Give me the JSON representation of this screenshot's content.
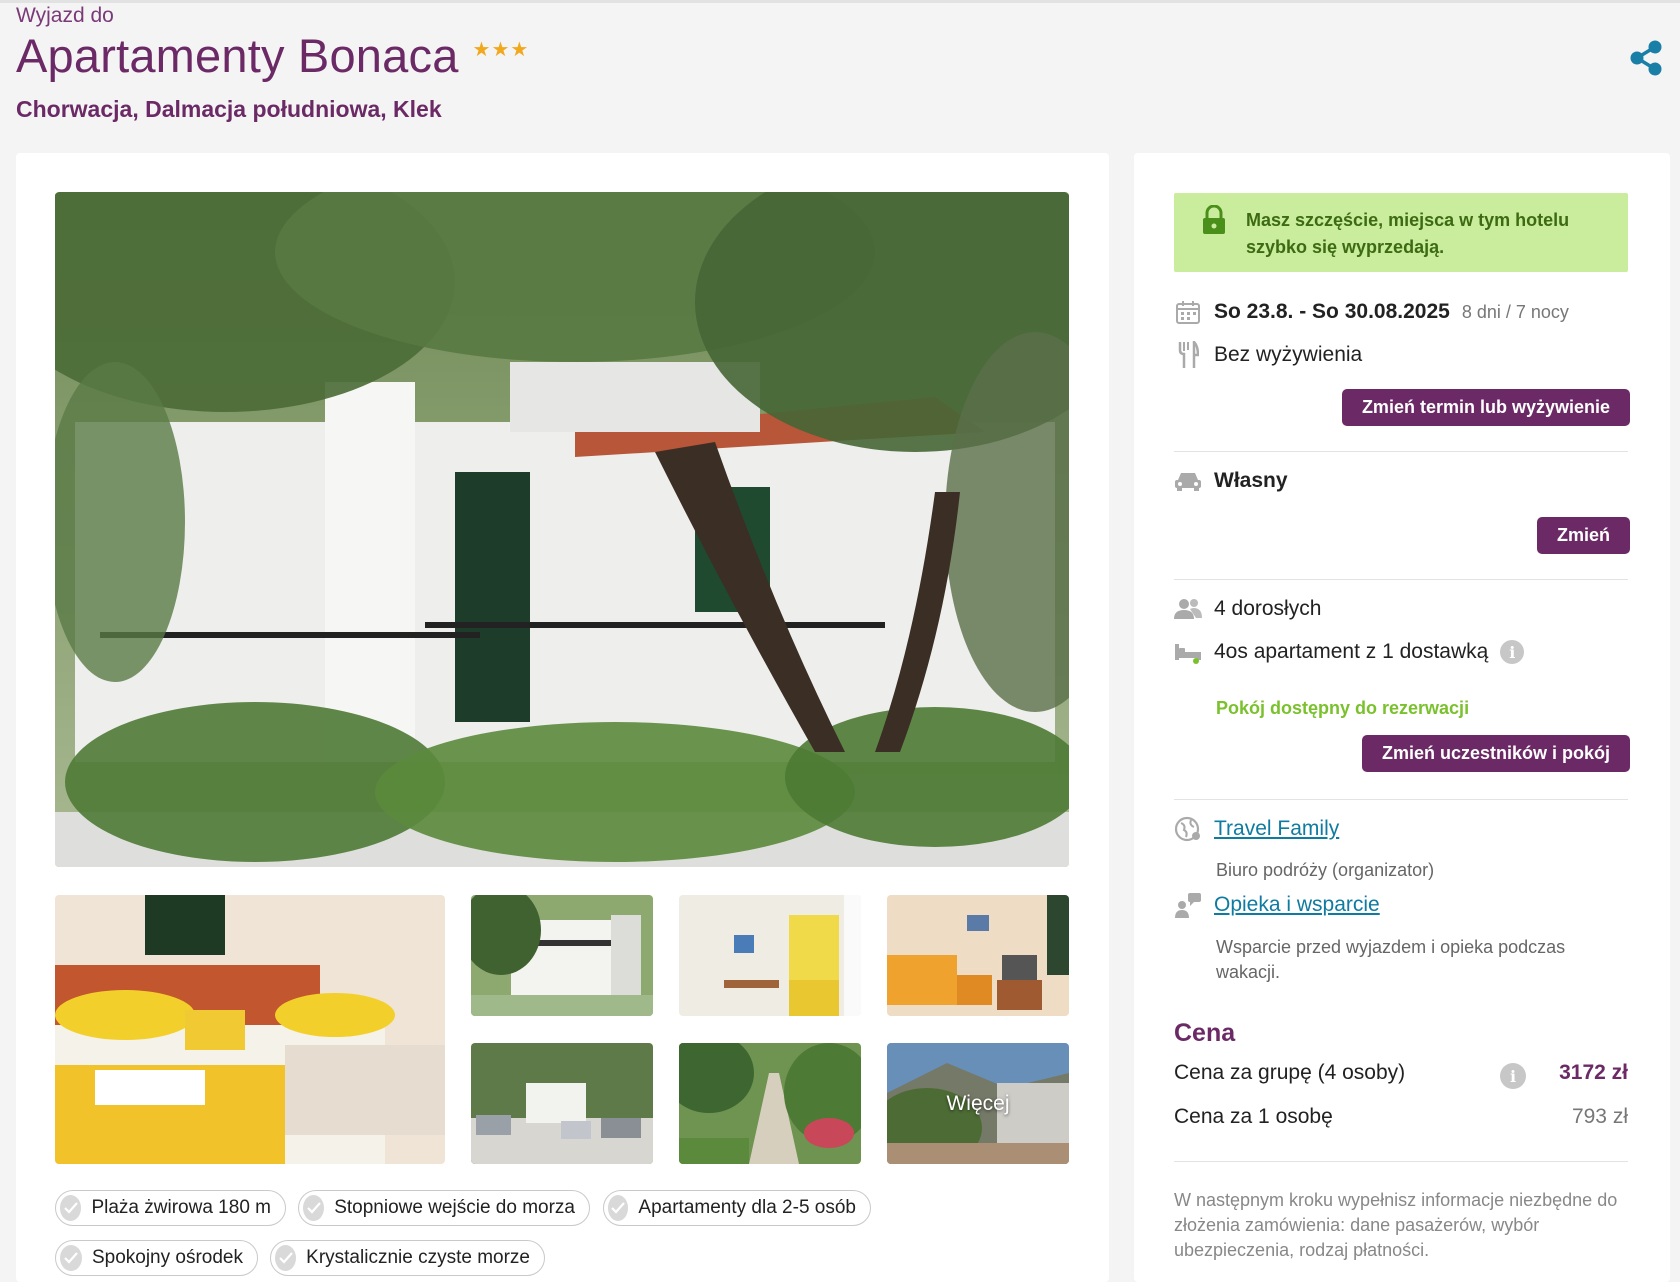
{
  "header": {
    "kicker": "Wyjazd do",
    "title": "Apartamenty Bonaca",
    "stars": "★★★",
    "location": "Chorwacja, Dalmacja południowa, Klek"
  },
  "gallery": {
    "more_label": "Więcej"
  },
  "tags": [
    "Plaża żwirowa 180 m",
    "Stopniowe wejście do morza",
    "Apartamenty dla 2-5 osób",
    "Spokojny ośrodek",
    "Krystalicznie czyste morze"
  ],
  "sidebar": {
    "alert": "Masz szczęście, miejsca w tym hotelu szybko się wyprzedają.",
    "dates": "So 23.8. - So 30.08.2025",
    "duration": "8 dni / 7 nocy",
    "board": "Bez wyżywienia",
    "change_date_button": "Zmień termin lub wyżywienie",
    "transport": "Własny",
    "change_transport_button": "Zmień",
    "travellers": "4 dorosłych",
    "room": "4os apartament z 1 dostawką",
    "room_status": "Pokój dostępny do rezerwacji",
    "change_room_button": "Zmień uczestników i pokój",
    "organizer_link": "Travel Family",
    "organizer_sub": "Biuro podróży (organizator)",
    "support_link": "Opieka i wsparcie",
    "support_sub": "Wsparcie przed wyjazdem i opieka podczas wakacji.",
    "price_title": "Cena",
    "price_group_label": "Cena za grupę (4 osoby)",
    "price_group_value": "3172 zł",
    "price_person_label": "Cena za 1 osobę",
    "price_person_value": "793 zł",
    "note": "W następnym kroku wypełnisz informacje niezbędne do złożenia zamówienia: dane pasażerów, wybór ubezpieczenia, rodzaj płatności."
  },
  "colors": {
    "brand": "#6b2a66",
    "link": "#0f7ba0",
    "success": "#7ac12d",
    "alert_bg": "#c9ec9d",
    "star": "#f2a81d"
  },
  "icons": [
    "share-icon",
    "lock-icon",
    "calendar-icon",
    "cutlery-icon",
    "car-icon",
    "people-icon",
    "bed-icon",
    "info-icon",
    "globe-icon",
    "support-icon",
    "check-icon"
  ]
}
